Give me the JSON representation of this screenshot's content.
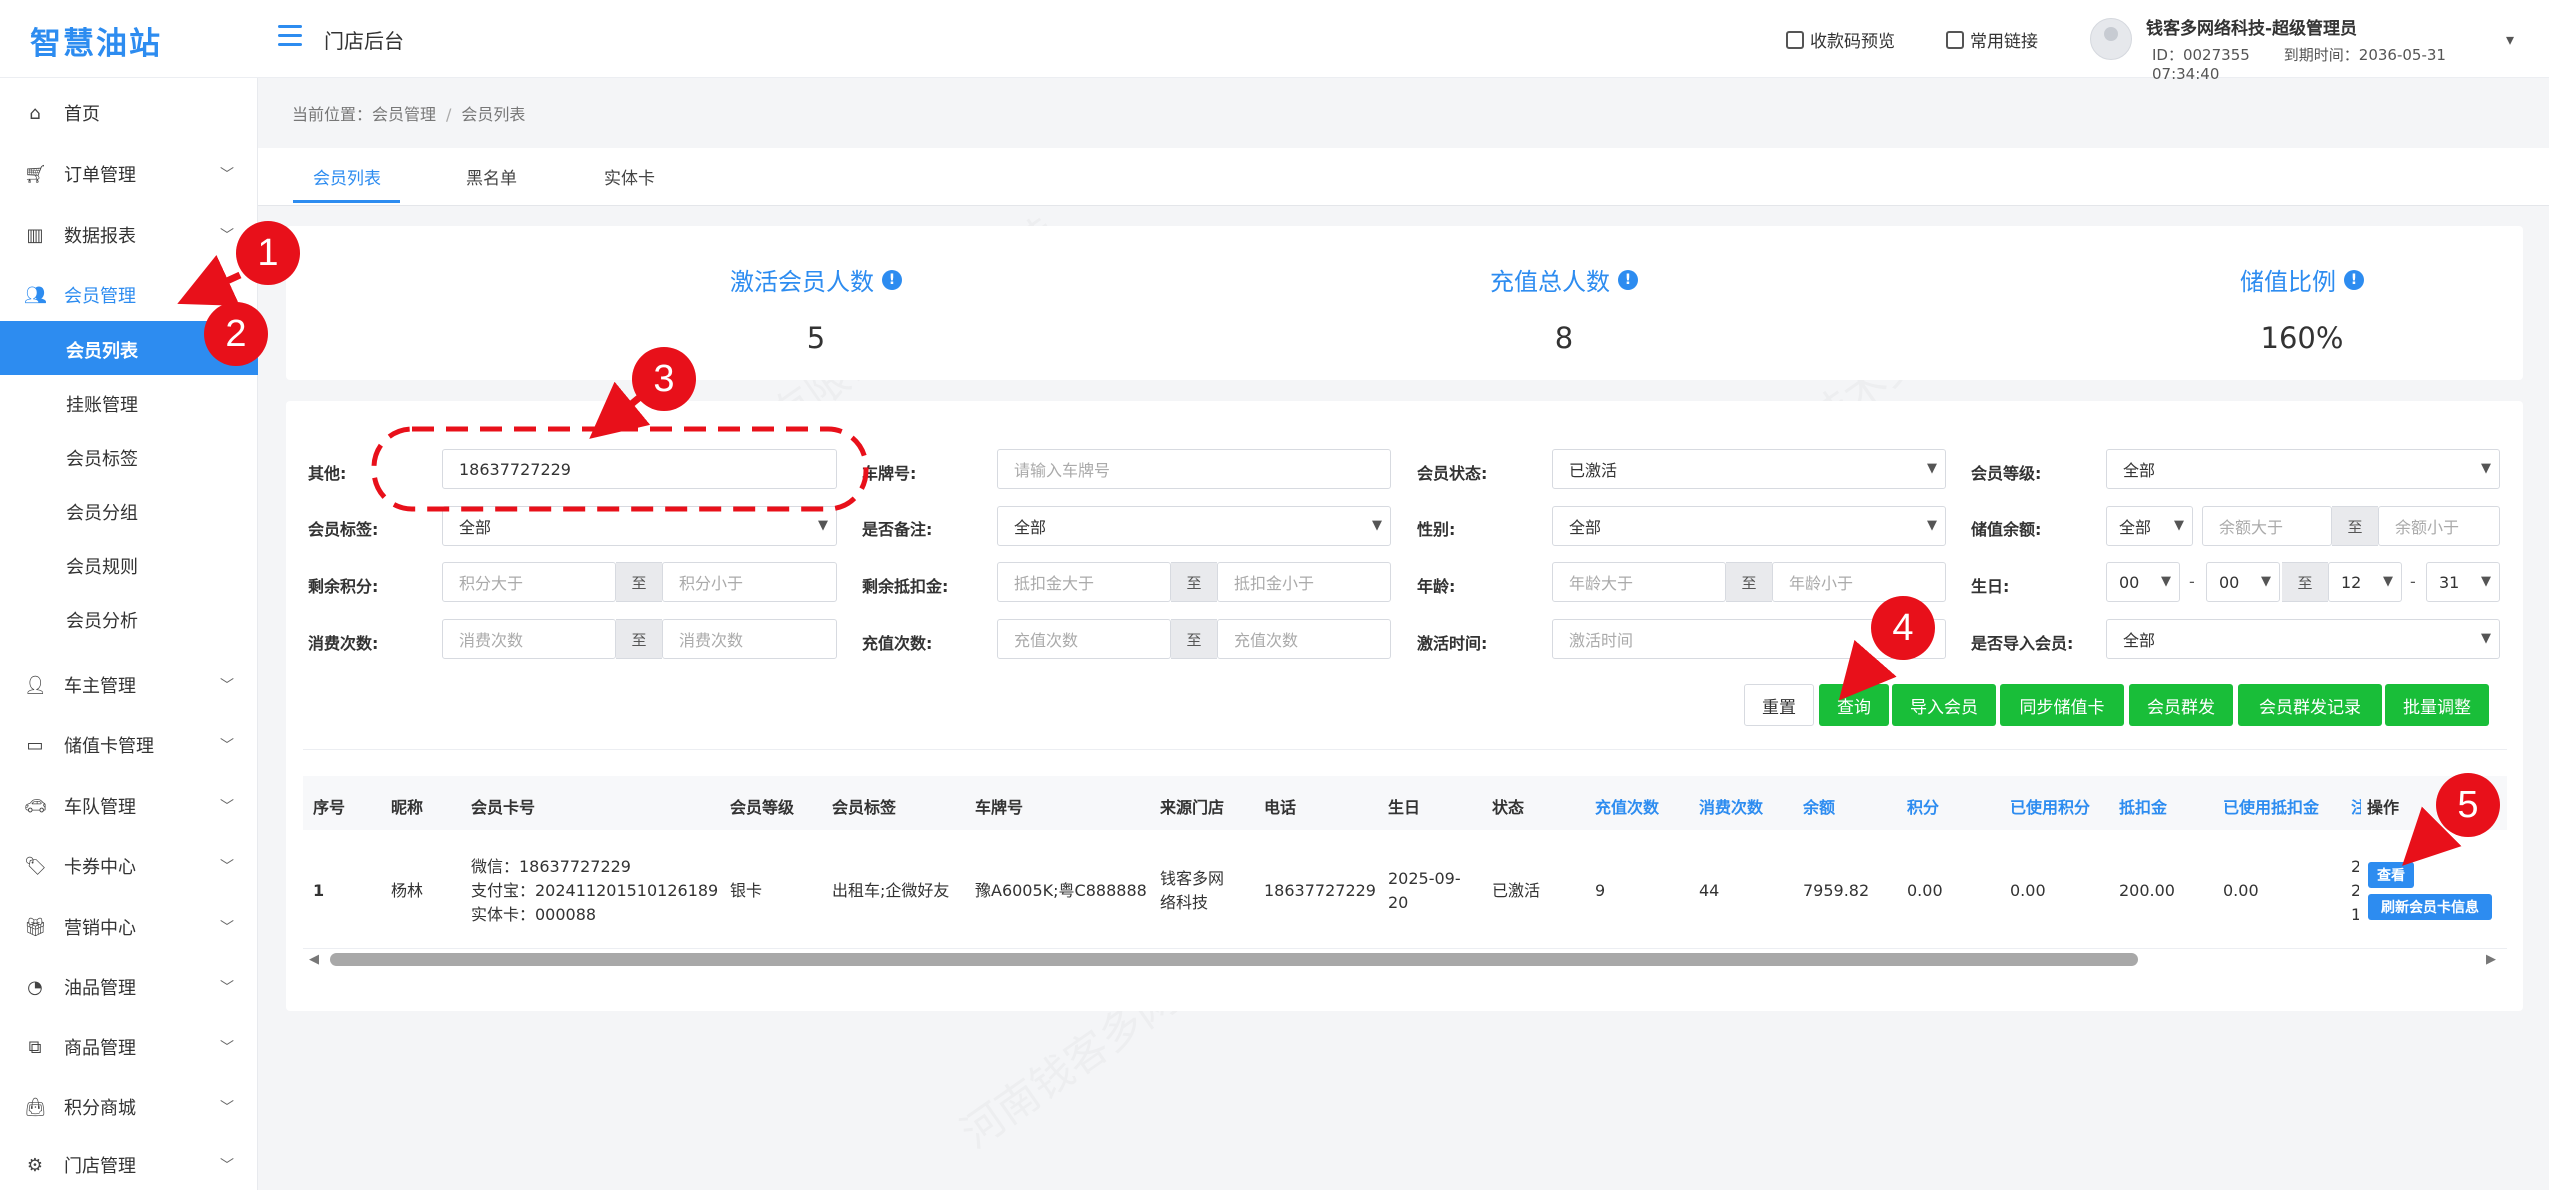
{
  "brand": "智慧油站",
  "header": {
    "title": "门店后台",
    "qr_preview": "收款码预览",
    "common_links": "常用链接",
    "user_name": "钱客多网络科技-超级管理员",
    "user_id": "ID：0027355",
    "expire": "到期时间：2036-05-31 07:34:40"
  },
  "sidebar": {
    "items": [
      {
        "label": "首页",
        "icon": "home-icon"
      },
      {
        "label": "订单管理",
        "icon": "cart-icon"
      },
      {
        "label": "数据报表",
        "icon": "bar-chart-icon"
      },
      {
        "label": "会员管理",
        "icon": "users-icon"
      },
      {
        "label": "车主管理",
        "icon": "user-icon"
      },
      {
        "label": "储值卡管理",
        "icon": "card-icon"
      },
      {
        "label": "车队管理",
        "icon": "car-icon"
      },
      {
        "label": "卡券中心",
        "icon": "tags-icon"
      },
      {
        "label": "营销中心",
        "icon": "gift-icon"
      },
      {
        "label": "油品管理",
        "icon": "gauge-icon"
      },
      {
        "label": "商品管理",
        "icon": "cubes-icon"
      },
      {
        "label": "积分商城",
        "icon": "shopping-bag-icon"
      },
      {
        "label": "门店管理",
        "icon": "cogs-icon"
      }
    ],
    "sub_items": [
      "会员列表",
      "挂账管理",
      "会员标签",
      "会员分组",
      "会员规则",
      "会员分析"
    ]
  },
  "breadcrumb": {
    "prefix": "当前位置：",
    "level1": "会员管理",
    "sep": "/",
    "level2": "会员列表"
  },
  "tabs": [
    "会员列表",
    "黑名单",
    "实体卡"
  ],
  "stats": [
    {
      "title": "激活会员人数",
      "value": "5"
    },
    {
      "title": "充值总人数",
      "value": "8"
    },
    {
      "title": "储值比例",
      "value": "160%"
    }
  ],
  "filters": {
    "other_label": "其他:",
    "other_value": "18637727229",
    "plate_label": "车牌号:",
    "plate_placeholder": "请输入车牌号",
    "status_label": "会员状态:",
    "status_value": "已激活",
    "level_label": "会员等级:",
    "level_value": "全部",
    "tag_label": "会员标签:",
    "tag_value": "全部",
    "remark_label": "是否备注:",
    "remark_value": "全部",
    "gender_label": "性别:",
    "gender_value": "全部",
    "balance_label": "储值余额:",
    "balance_select": "全部",
    "balance_min": "余额大于",
    "balance_max": "余额小于",
    "points_label": "剩余积分:",
    "points_min": "积分大于",
    "points_max": "积分小于",
    "deduct_label": "剩余抵扣金:",
    "deduct_min": "抵扣金大于",
    "deduct_max": "抵扣金小于",
    "age_label": "年龄:",
    "age_min": "年龄大于",
    "age_max": "年龄小于",
    "birthday_label": "生日:",
    "bday_m1": "00",
    "bday_d1": "00",
    "bday_m2": "12",
    "bday_d2": "31",
    "dash": "-",
    "consume_label": "消费次数:",
    "consume_min": "消费次数",
    "consume_max": "消费次数",
    "recharge_label": "充值次数:",
    "recharge_min": "充值次数",
    "recharge_max": "充值次数",
    "activate_label": "激活时间:",
    "activate_placeholder": "激活时间",
    "imported_label": "是否导入会员:",
    "imported_value": "全部",
    "to": "至"
  },
  "buttons": {
    "reset": "重置",
    "query": "查询",
    "import": "导入会员",
    "sync": "同步储值卡",
    "mass": "会员群发",
    "mass_log": "会员群发记录",
    "batch": "批量调整"
  },
  "table": {
    "headers": [
      "序号",
      "昵称",
      "会员卡号",
      "会员等级",
      "会员标签",
      "车牌号",
      "来源门店",
      "电话",
      "生日",
      "状态",
      "充值次数",
      "消费次数",
      "余额",
      "积分",
      "已使用积分",
      "抵扣金",
      "已使用抵扣金",
      "注",
      "操作"
    ],
    "row": {
      "index": "1",
      "nickname": "杨林",
      "card_wechat": "微信：18637727229",
      "card_alipay": "支付宝：202411201510126189",
      "card_physical": "实体卡：000088",
      "level": "银卡",
      "tags": "出租车;企微好友",
      "plate": "豫A6005K;粤C888888",
      "store_1": "钱客多网",
      "store_2": "络科技",
      "phone": "18637727229",
      "birthday_1": "2025-09-",
      "birthday_2": "20",
      "status": "已激活",
      "recharge_times": "9",
      "consume_times": "44",
      "balance": "7959.82",
      "points": "0.00",
      "used_points": "0.00",
      "deduct": "200.00",
      "used_deduct": "0.00",
      "clip_1": "2",
      "clip_2": "2",
      "clip_3": "1",
      "view": "查看",
      "refresh": "刷新会员卡信息"
    }
  },
  "annotations": [
    "1",
    "2",
    "3",
    "4",
    "5"
  ],
  "colors": {
    "accent": "#2d8cf0",
    "green": "#19be39",
    "annotation": "#e8101a"
  }
}
